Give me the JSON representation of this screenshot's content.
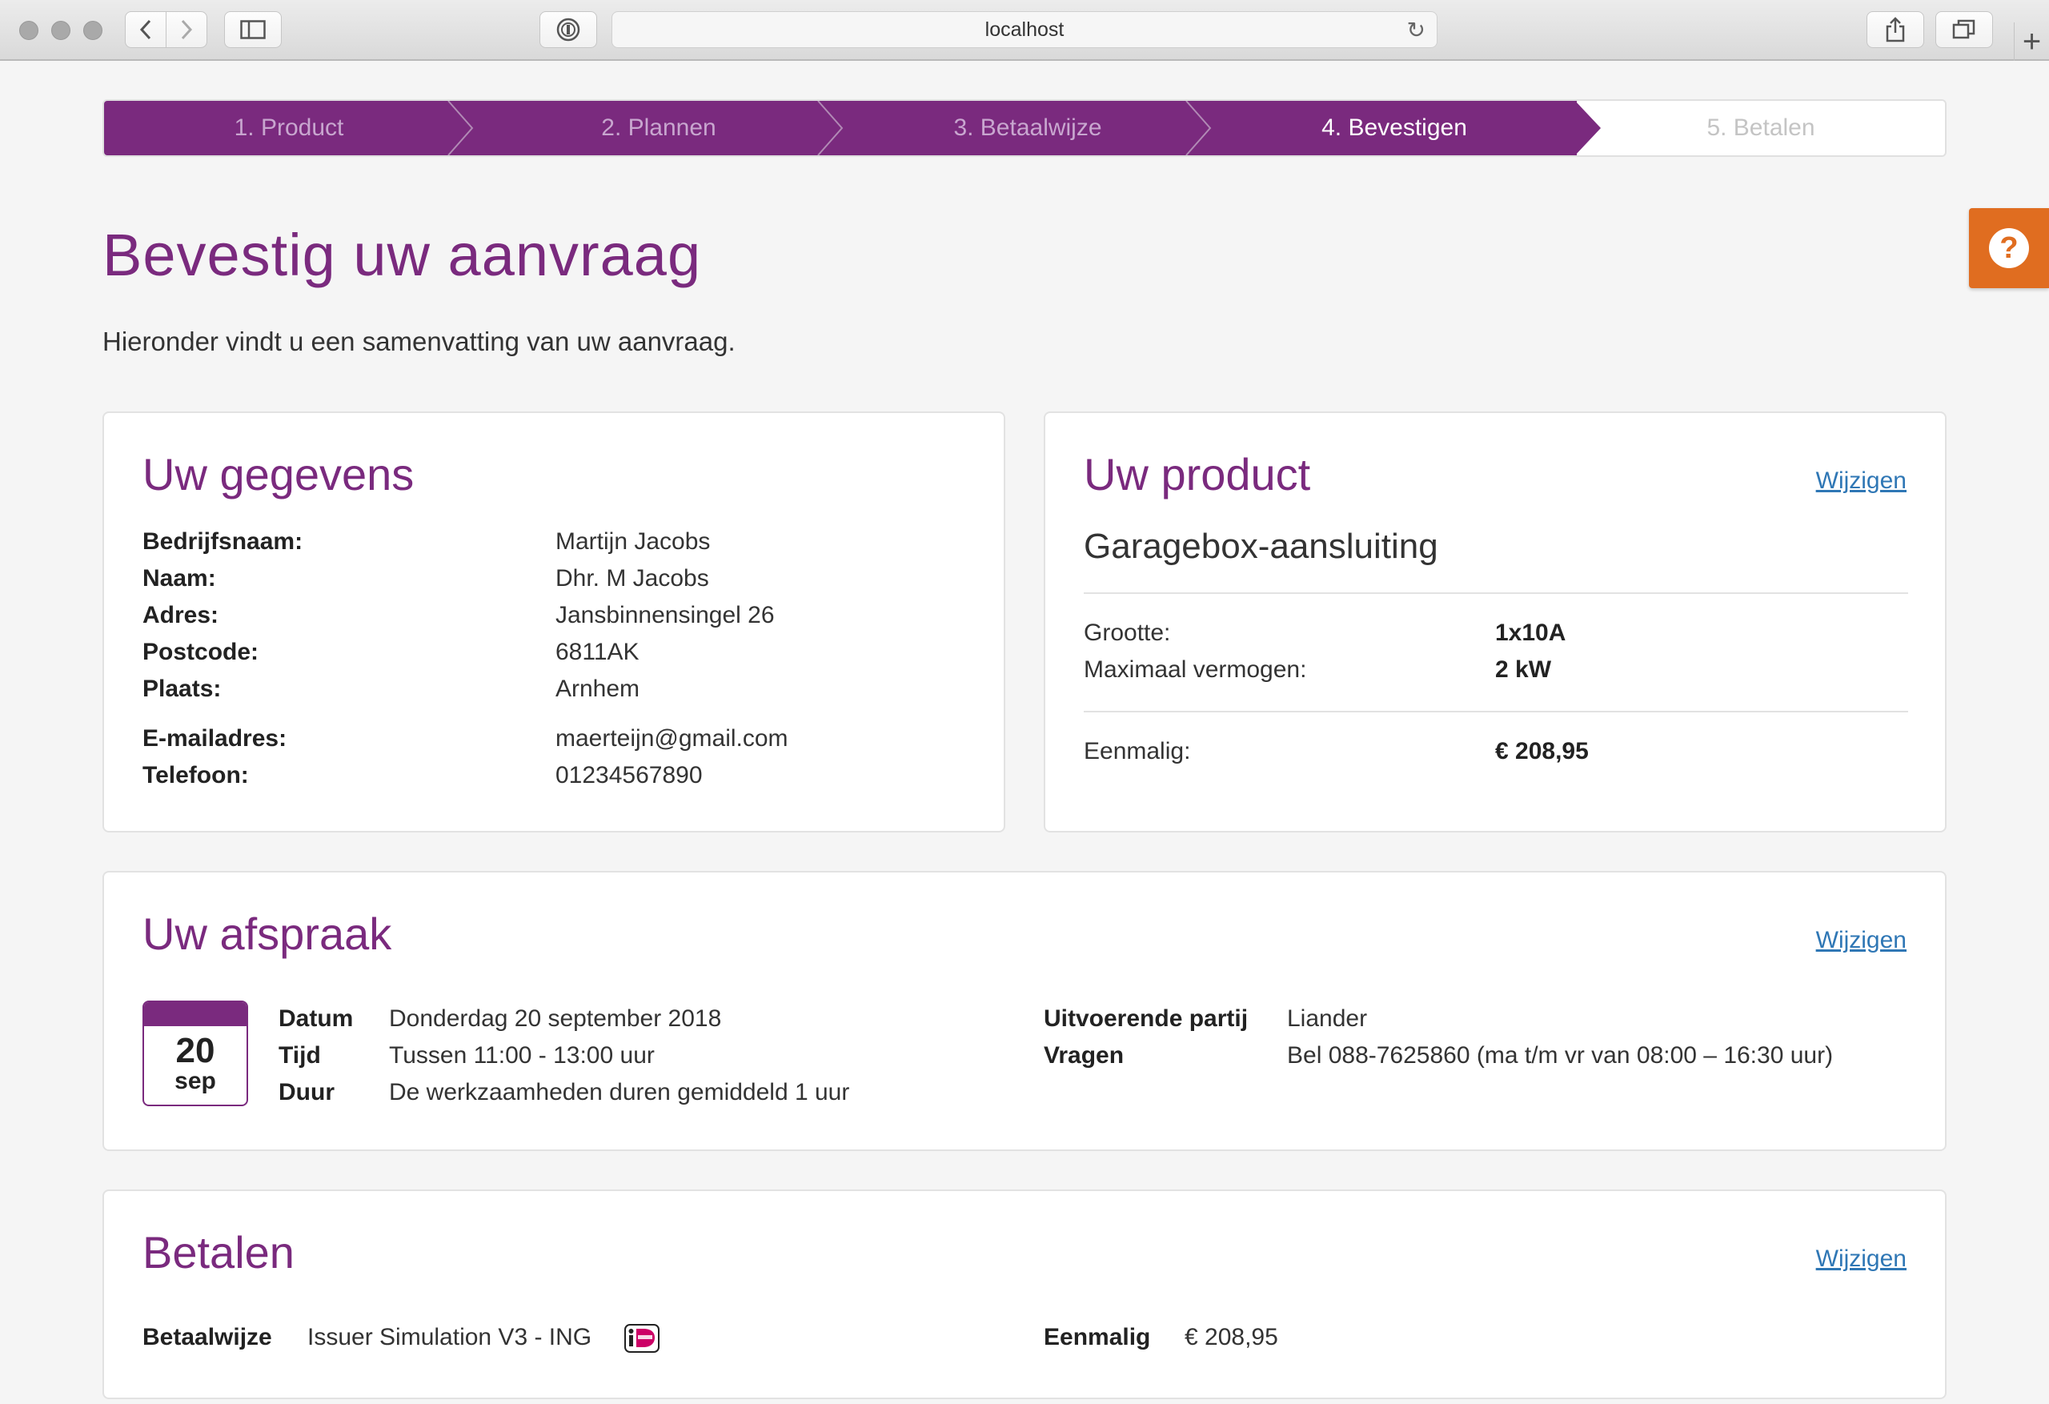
{
  "browser": {
    "url": "localhost"
  },
  "stepper": {
    "steps": [
      {
        "label": "1. Product",
        "state": "done"
      },
      {
        "label": "2. Plannen",
        "state": "done"
      },
      {
        "label": "3. Betaalwijze",
        "state": "done"
      },
      {
        "label": "4. Bevestigen",
        "state": "active"
      },
      {
        "label": "5. Betalen",
        "state": "todo"
      }
    ]
  },
  "help": {
    "icon": "question-icon",
    "glyph": "?"
  },
  "page": {
    "title": "Bevestig uw aanvraag",
    "intro": "Hieronder vindt u een samenvatting van uw aanvraag."
  },
  "gegevens": {
    "title": "Uw gegevens",
    "rows": [
      {
        "label": "Bedrijfsnaam:",
        "value": "Martijn Jacobs"
      },
      {
        "label": "Naam:",
        "value": "Dhr. M Jacobs"
      },
      {
        "label": "Adres:",
        "value": "Jansbinnensingel 26"
      },
      {
        "label": "Postcode:",
        "value": "6811AK"
      },
      {
        "label": "Plaats:",
        "value": "Arnhem"
      },
      {
        "label": "E-mailadres:",
        "value": "maerteijn@gmail.com"
      },
      {
        "label": "Telefoon:",
        "value": "01234567890"
      }
    ]
  },
  "product": {
    "title": "Uw product",
    "edit_label": "Wijzigen",
    "name": "Garagebox-aansluiting",
    "specs": [
      {
        "label": "Grootte:",
        "value": "1x10A"
      },
      {
        "label": "Maximaal vermogen:",
        "value": "2 kW"
      }
    ],
    "price_label": "Eenmalig:",
    "price_value": "€ 208,95"
  },
  "afspraak": {
    "title": "Uw afspraak",
    "edit_label": "Wijzigen",
    "calendar": {
      "day": "20",
      "month": "sep"
    },
    "details": [
      {
        "label": "Datum",
        "value": "Donderdag 20 september 2018"
      },
      {
        "label": "Tijd",
        "value": "Tussen 11:00 - 13:00 uur"
      },
      {
        "label": "Duur",
        "value": "De werkzaamheden duren gemiddeld 1 uur"
      }
    ],
    "extra": [
      {
        "label": "Uitvoerende partij",
        "value": "Liander"
      },
      {
        "label": "Vragen",
        "value": "Bel 088-7625860 (ma t/m vr van 08:00 – 16:30 uur)"
      }
    ]
  },
  "betalen": {
    "title": "Betalen",
    "edit_label": "Wijzigen",
    "method_label": "Betaalwijze",
    "method_value": "Issuer Simulation V3 - ING",
    "method_logo": "ideal-logo",
    "amount_label": "Eenmalig",
    "amount_value": "€ 208,95"
  },
  "colors": {
    "brand": "#7a2a7e",
    "help": "#e06d20",
    "link": "#2f77b5"
  }
}
